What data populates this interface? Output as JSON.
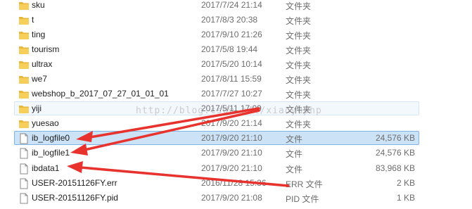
{
  "files": [
    {
      "name": "sku",
      "date": "2017/7/24 21:14",
      "type": "文件夹",
      "size": "",
      "kind": "folder"
    },
    {
      "name": "t",
      "date": "2017/8/3 20:38",
      "type": "文件夹",
      "size": "",
      "kind": "folder"
    },
    {
      "name": "ting",
      "date": "2017/9/10 21:26",
      "type": "文件夹",
      "size": "",
      "kind": "folder"
    },
    {
      "name": "tourism",
      "date": "2017/5/8 19:44",
      "type": "文件夹",
      "size": "",
      "kind": "folder"
    },
    {
      "name": "ultrax",
      "date": "2017/5/20 10:14",
      "type": "文件夹",
      "size": "",
      "kind": "folder"
    },
    {
      "name": "we7",
      "date": "2017/8/11 15:59",
      "type": "文件夹",
      "size": "",
      "kind": "folder"
    },
    {
      "name": "webshop_b_2017_07_27_01_01_01",
      "date": "2017/7/27 10:27",
      "type": "文件夹",
      "size": "",
      "kind": "folder"
    },
    {
      "name": "yiji",
      "date": "2017/5/11 17:09",
      "type": "文件夹",
      "size": "",
      "kind": "folder"
    },
    {
      "name": "yuesao",
      "date": "2017/9/20 21:14",
      "type": "文件夹",
      "size": "",
      "kind": "folder"
    },
    {
      "name": "ib_logfile0",
      "date": "2017/9/20 21:10",
      "type": "文件",
      "size": "24,576 KB",
      "kind": "file"
    },
    {
      "name": "ib_logfile1",
      "date": "2017/9/20 21:10",
      "type": "文件",
      "size": "24,576 KB",
      "kind": "file"
    },
    {
      "name": "ibdata1",
      "date": "2017/9/20 21:10",
      "type": "文件",
      "size": "83,968 KB",
      "kind": "file"
    },
    {
      "name": "USER-20151126FY.err",
      "date": "2016/11/28 15:36",
      "type": "ERR 文件",
      "size": "2 KB",
      "kind": "file"
    },
    {
      "name": "USER-20151126FY.pid",
      "date": "2017/9/20 21:08",
      "type": "PID 文件",
      "size": "1 KB",
      "kind": "file"
    }
  ],
  "watermark": "http://blog.csdn.net/xiaoyuphp",
  "colors": {
    "folder": "#e8b73a",
    "arrow": "#e8322d",
    "selection": "#cce3f7"
  }
}
